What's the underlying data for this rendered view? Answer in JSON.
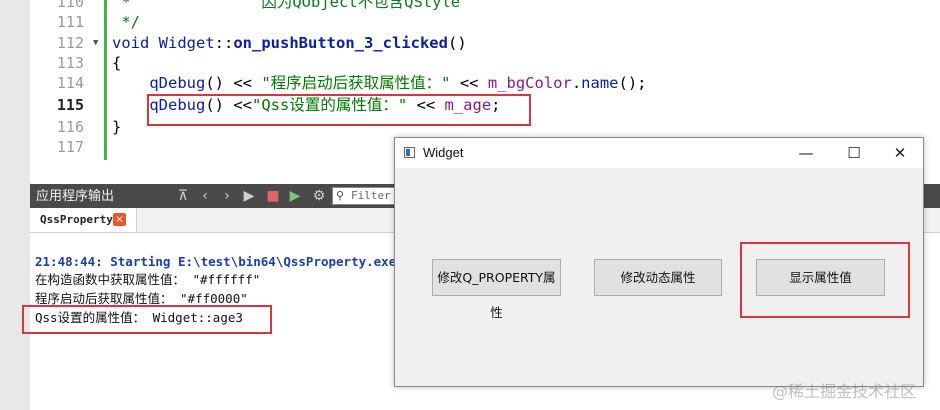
{
  "editor": {
    "lines": [
      {
        "num": "110",
        "parts": [
          {
            "t": " *              ",
            "c": "cmt"
          },
          {
            "t": "因为QObject不包含QStyle",
            "c": "cmt"
          }
        ]
      },
      {
        "num": "111",
        "parts": [
          {
            "t": " */",
            "c": "cmt"
          }
        ]
      },
      {
        "num": "112",
        "parts": [
          {
            "t": "void ",
            "c": "kw"
          },
          {
            "t": "Widget",
            "c": "call"
          },
          {
            "t": "::",
            "c": ""
          },
          {
            "t": "on_pushButton_3_clicked",
            "c": "fn"
          },
          {
            "t": "()",
            "c": ""
          }
        ]
      },
      {
        "num": "113",
        "parts": [
          {
            "t": "{",
            "c": ""
          }
        ]
      },
      {
        "num": "114",
        "parts": [
          {
            "t": "    ",
            "c": ""
          },
          {
            "t": "qDebug",
            "c": "call"
          },
          {
            "t": "() << ",
            "c": ""
          },
          {
            "t": "\"程序启动后获取属性值：\"",
            "c": "str"
          },
          {
            "t": " << ",
            "c": ""
          },
          {
            "t": "m_bgColor",
            "c": "var"
          },
          {
            "t": ".",
            "c": ""
          },
          {
            "t": "name",
            "c": "call"
          },
          {
            "t": "();",
            "c": ""
          }
        ]
      },
      {
        "num": "115",
        "parts": [
          {
            "t": "    ",
            "c": ""
          },
          {
            "t": "qDebug",
            "c": "call"
          },
          {
            "t": "() <<",
            "c": ""
          },
          {
            "t": "\"Qss设置的属性值：\"",
            "c": "str"
          },
          {
            "t": " << ",
            "c": ""
          },
          {
            "t": "m_age",
            "c": "var"
          },
          {
            "t": ";",
            "c": ""
          }
        ]
      },
      {
        "num": "116",
        "parts": [
          {
            "t": "}",
            "c": ""
          }
        ]
      },
      {
        "num": "117",
        "parts": []
      }
    ]
  },
  "output_panel": {
    "title": "应用程序输出",
    "filter_placeholder": "Filter",
    "tab_label": "QssProperty",
    "tab_close": "×",
    "lines": [
      {
        "text": "21:48:44: Starting E:\\test\\bin64\\QssProperty.exe...",
        "style": "start"
      },
      {
        "text": "在构造函数中获取属性值： \"#ffffff\"",
        "style": ""
      },
      {
        "text": "程序启动后获取属性值： \"#ff0000\"",
        "style": ""
      },
      {
        "text": "Qss设置的属性值： Widget::age3",
        "style": ""
      }
    ]
  },
  "widget_window": {
    "title": "Widget",
    "minimize": "—",
    "maximize": "☐",
    "close": "✕",
    "buttons": {
      "modify_q_property": "修改Q_PROPERTY属性",
      "modify_dynamic": "修改动态属性",
      "show_property": "显示属性值"
    }
  },
  "watermark": "@稀土掘金技术社区",
  "colors": {
    "highlight_box": "#d9363e",
    "output_header": "#4a4a4a",
    "fold_bar": "#4caf50"
  }
}
